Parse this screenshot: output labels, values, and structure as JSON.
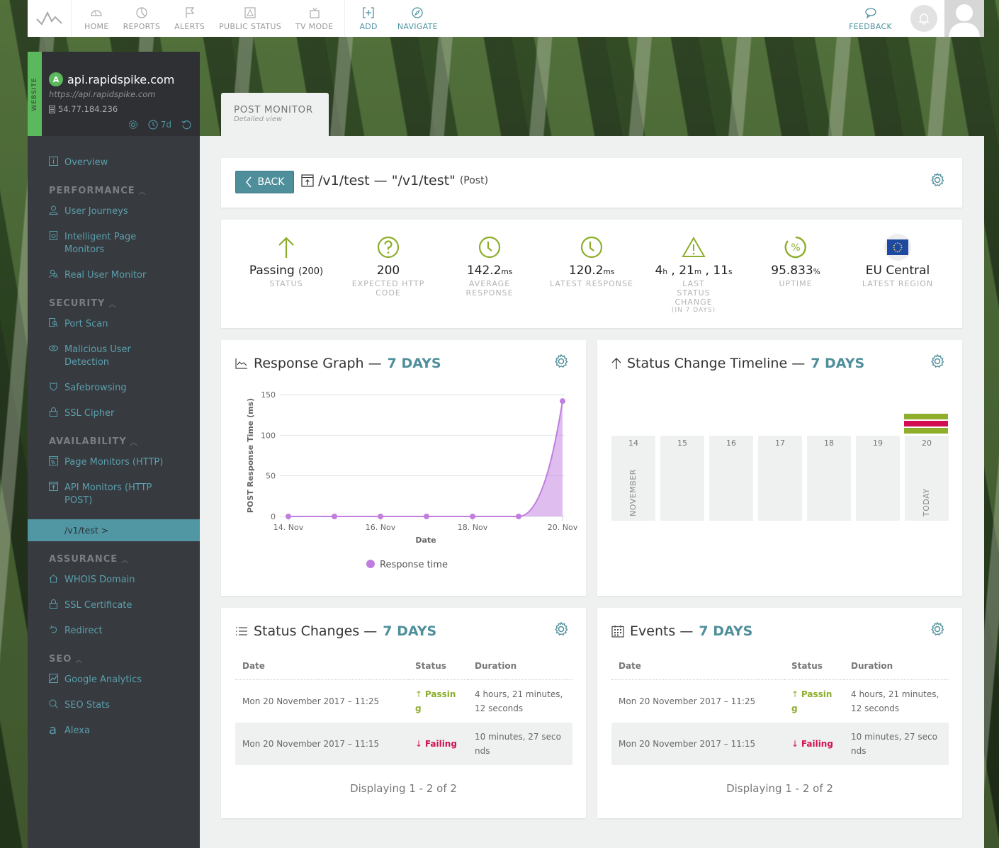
{
  "topnav": {
    "items": [
      {
        "label": "HOME",
        "icon": "home-gauge-icon"
      },
      {
        "label": "REPORTS",
        "icon": "pie-chart-icon"
      },
      {
        "label": "ALERTS",
        "icon": "flag-icon"
      },
      {
        "label": "PUBLIC STATUS",
        "icon": "warning-icon"
      },
      {
        "label": "TV MODE",
        "icon": "tv-icon"
      }
    ],
    "actions": [
      {
        "label": "ADD",
        "icon": "add-icon"
      },
      {
        "label": "NAVIGATE",
        "icon": "compass-icon"
      }
    ],
    "feedback_label": "FEEDBACK"
  },
  "site": {
    "type_label": "WEBSITE",
    "badge": "A",
    "name": "api.rapidspike.com",
    "url": "https://api.rapidspike.com",
    "ip": "54.77.184.236",
    "period": "7d"
  },
  "sidebar": {
    "overview": "Overview",
    "sections": [
      {
        "title": "PERFORMANCE",
        "items": [
          "User Journeys",
          "Intelligent Page Monitors",
          "Real User Monitor"
        ]
      },
      {
        "title": "SECURITY",
        "items": [
          "Port Scan",
          "Malicious User Detection",
          "Safebrowsing",
          "SSL Cipher"
        ]
      },
      {
        "title": "AVAILABILITY",
        "items": [
          "Page Monitors (HTTP)",
          "API Monitors (HTTP POST)"
        ]
      },
      {
        "title": "ASSURANCE",
        "items": [
          "WHOIS Domain",
          "SSL Certificate",
          "Redirect"
        ]
      },
      {
        "title": "SEO",
        "items": [
          "Google Analytics",
          "SEO Stats",
          "Alexa"
        ]
      }
    ],
    "active_item": "/v1/test >"
  },
  "tab": {
    "title": "POST MONITOR",
    "subtitle": "Detailed view"
  },
  "header": {
    "back_label": "BACK",
    "title": "/v1/test — \"/v1/test\"",
    "method": "(Post)"
  },
  "stats": [
    {
      "value": "Passing",
      "suffix": "(200)",
      "label": "STATUS",
      "icon": "arrow-up-icon"
    },
    {
      "value": "200",
      "suffix": "",
      "label": "EXPECTED HTTP CODE",
      "icon": "question-icon"
    },
    {
      "value": "142.2",
      "suffix": "ms",
      "label": "AVERAGE RESPONSE",
      "icon": "clock-icon"
    },
    {
      "value": "120.2",
      "suffix": "ms",
      "label": "LATEST RESPONSE",
      "icon": "clock-icon"
    },
    {
      "value_parts": [
        "4",
        "h",
        " , 21",
        "m",
        " , 11",
        "s"
      ],
      "label": "LAST STATUS CHANGE",
      "sublabel": "(IN 7 DAYS)",
      "icon": "warning-icon"
    },
    {
      "value": "95.833",
      "suffix": "%",
      "label": "UPTIME",
      "icon": "percent-icon"
    },
    {
      "value": "EU Central",
      "suffix": "",
      "label": "LATEST REGION",
      "icon": "eu-flag-icon"
    }
  ],
  "response_graph": {
    "title": "Response Graph — ",
    "period": "7 DAYS"
  },
  "chart_data": {
    "type": "area",
    "title": "",
    "xlabel": "Date",
    "ylabel": "POST Response Time (ms)",
    "x": [
      "14. Nov",
      "15. Nov",
      "16. Nov",
      "17. Nov",
      "18. Nov",
      "19. Nov",
      "20. Nov"
    ],
    "x_tick_labels": [
      "14. Nov",
      "16. Nov",
      "18. Nov",
      "20. Nov"
    ],
    "y_ticks": [
      0,
      50,
      100,
      150
    ],
    "ylim": [
      0,
      150
    ],
    "grid": true,
    "legend": "bottom-center",
    "series": [
      {
        "name": "Response time",
        "color": "#c07ee0",
        "values": [
          0,
          0,
          0,
          0,
          0,
          0,
          142
        ]
      }
    ]
  },
  "timeline": {
    "title": "Status Change Timeline — ",
    "period": "7 DAYS",
    "days": [
      "14",
      "15",
      "16",
      "17",
      "18",
      "19",
      "20"
    ],
    "month_label": "NOVEMBER",
    "today_label": "TODAY",
    "today_events": [
      "passing",
      "failing",
      "passing"
    ],
    "colors": {
      "passing": "#8fae2b",
      "failing": "#d30d52"
    }
  },
  "status_changes": {
    "title": "Status Changes — ",
    "period": "7 DAYS",
    "columns": [
      "Date",
      "Status",
      "Duration"
    ],
    "rows": [
      {
        "date": "Mon 20 November 2017 – 11:25",
        "status": "Passing",
        "duration": "4 hours, 21 minutes, 12 seconds"
      },
      {
        "date": "Mon 20 November 2017 – 11:15",
        "status": "Failing",
        "duration": "10 minutes, 27 seconds"
      }
    ],
    "pager": "Displaying 1 - 2 of 2"
  },
  "events": {
    "title": "Events — ",
    "period": "7 DAYS",
    "columns": [
      "Date",
      "Status",
      "Duration"
    ],
    "rows": [
      {
        "date": "Mon 20 November 2017 – 11:25",
        "status": "Passing",
        "duration": "4 hours, 21 minutes, 12 seconds"
      },
      {
        "date": "Mon 20 November 2017 – 11:15",
        "status": "Failing",
        "duration": "10 minutes, 27 seconds"
      }
    ],
    "pager": "Displaying 1 - 2 of 2"
  },
  "colors": {
    "accent": "#4f8f9b",
    "sidebar_bg": "#373a3f",
    "pass": "#8cae2c",
    "fail": "#d01354",
    "chart": "#c07ee0"
  }
}
